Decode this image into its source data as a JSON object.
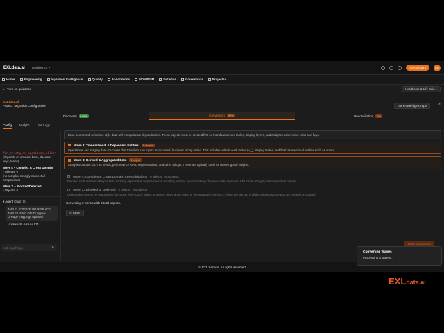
{
  "topbar": {
    "brand": "EXLdata.ai",
    "workbench": "Workbench",
    "ai_button": "AI Assistant",
    "user_initials": "CR"
  },
  "nav": [
    {
      "label": "Home"
    },
    {
      "label": "Engineering"
    },
    {
      "label": "Ingestion Intelligence"
    },
    {
      "label": "Quality"
    },
    {
      "label": "Annotations"
    },
    {
      "label": "MDM/RDM"
    },
    {
      "label": "DataOps"
    },
    {
      "label": "Governance"
    },
    {
      "label": "Projects+"
    }
  ],
  "guidance": {
    "label": "Turn on guidance",
    "domain_pill": "Healthcare & Life Scie..."
  },
  "header": {
    "logo": "EXLdata.ai",
    "project": "Project: Migration Configuration",
    "kg_button": "DM Knowledge Graph"
  },
  "phases": [
    {
      "label": "Discovery",
      "badge": "100%"
    },
    {
      "label": "Conversion",
      "badge": "39%"
    },
    {
      "label": "Reconciliation",
      "badge": "0%"
    }
  ],
  "tabs": [
    "Config",
    "Analytic",
    "Live Logs"
  ],
  "left": {
    "code": "fin_er.stg_er_openitems_silver",
    "note1": "(depends on amount, base, duedate, keys, terms)",
    "wave4_title": "Wave 4 – Complex & Cross Domain",
    "wave4_objects": "• Objects: 0",
    "wave4_note": "(no complex strongly connected components)",
    "wavex_title": "Wave X – Blocked/Deferred",
    "wavex_objects": "• Objects: 0",
    "agent_chat": "Agent Chat (7)",
    "message": "TABLE→CREATE OR REPLACE TABLE USING DELTA applied. Lineage mappings updated.",
    "timestamp": "7/24/2026, 3:15:53 PM",
    "ask_placeholder": "Ask anything..."
  },
  "waves": [
    {
      "desc": "Base source and reference style data with no upstream dependencies. These objects must be created first so that downstream tables, staging layers, and analytics can resolve joins and keys."
    },
    {
      "title": "Wave 2: Transactional & Dependent Entities",
      "count": "5 objects",
      "desc": "Operational and staging data structures that transform raw inputs into curated, business facing tables. This includes volatile work tables (vt_), staging tables, and final transactional entities such as orders."
    },
    {
      "title": "Wave 3: Derived & Aggregated Data",
      "count": "1 object",
      "desc": "Analytics outputs such as trends, performance KPIs, segmentations, and other rollups. These are typically used for reporting and insights."
    },
    {
      "title": "Wave 4: Complex & Cross Domain Consolidations",
      "count": "0 objects",
      "status": "No objects",
      "desc": "Blended multi domain data products and any objects that require special handling such as cycle-breaking. These usually represent KPI marts or highly interdependent rollups."
    },
    {
      "title": "Wave X: Blocked or Deferred",
      "count": "0 objects",
      "status": "No objects",
      "desc": "Objects that cannot be migrated yet because their source tables or source views do not exist in the extracted inventory. These are parked until the missing upstreams are created or curated."
    }
  ],
  "converting": "Converting 3 waves with 8 total objects.",
  "reset": "Reset",
  "start_button": "Start Conversion",
  "footer": "© EXL Service. All rights reserved",
  "toast": {
    "title": "Converting Waves",
    "body": "Processing 3 waves..."
  },
  "logo": {
    "main": "EXL",
    "sub": "data.ai"
  }
}
